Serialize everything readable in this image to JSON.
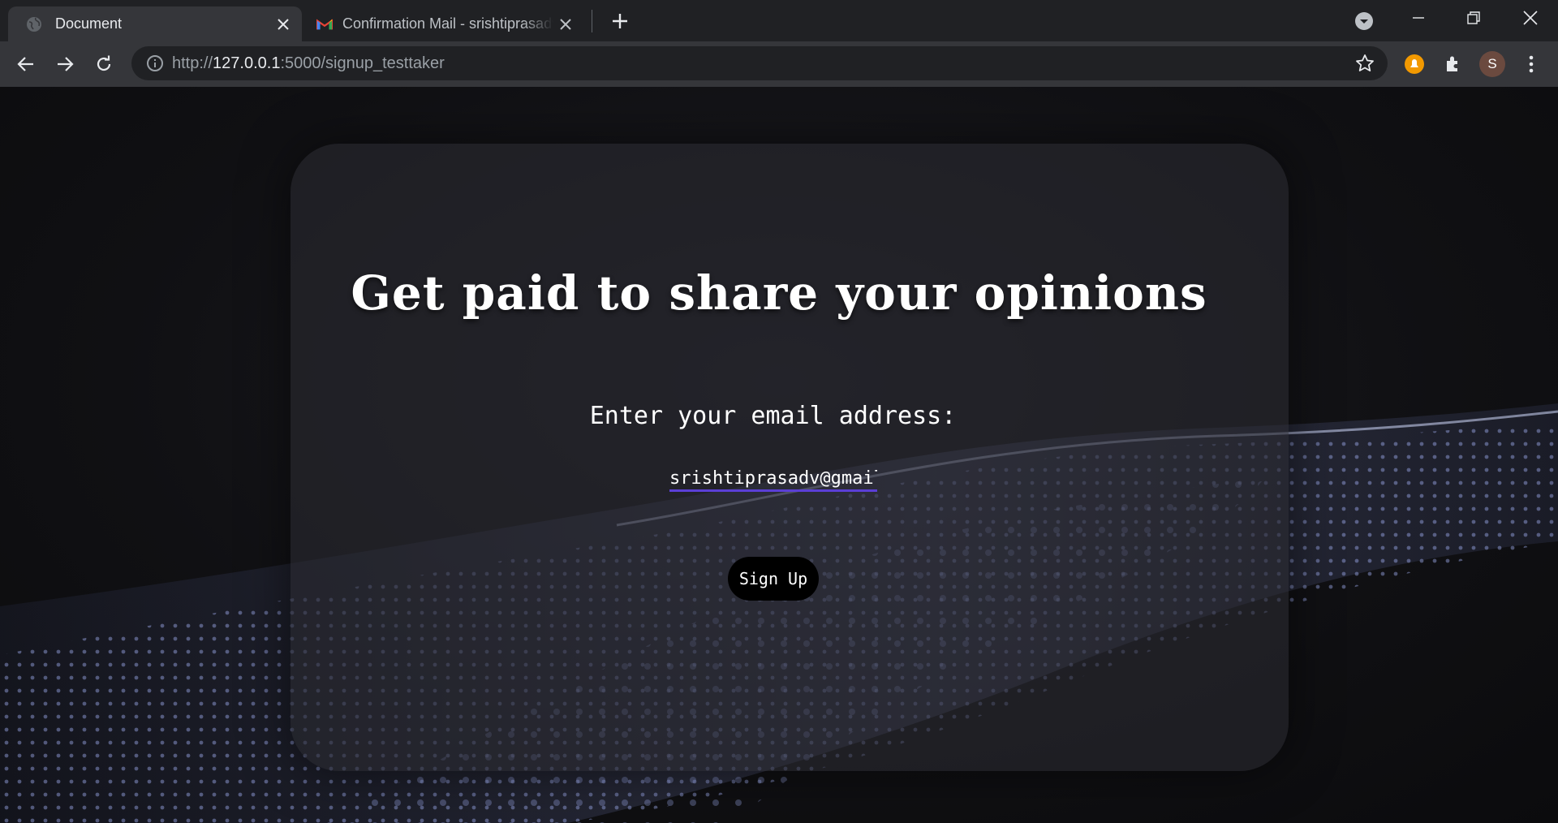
{
  "browser": {
    "tabs": [
      {
        "title": "Document",
        "active": true,
        "icon": "globe-icon"
      },
      {
        "title": "Confirmation Mail - srishtiprasadv",
        "active": false,
        "icon": "gmail-icon"
      }
    ],
    "address": {
      "scheme": "http://",
      "host": "127.0.0.1",
      "rest": ":5000/signup_testtaker"
    },
    "extensions": [
      "notification-extension-icon",
      "puzzle-extensions-icon"
    ],
    "profile_initial": "S"
  },
  "page": {
    "headline": "Get paid to share your opinions",
    "prompt": "Enter your email address:",
    "email_value": "srishtiprasadv@gmail.com",
    "signup_label": "Sign Up"
  },
  "colors": {
    "input_underline": "#5b3fd6",
    "button_bg": "#000000",
    "wave": "#a9b8ff"
  }
}
